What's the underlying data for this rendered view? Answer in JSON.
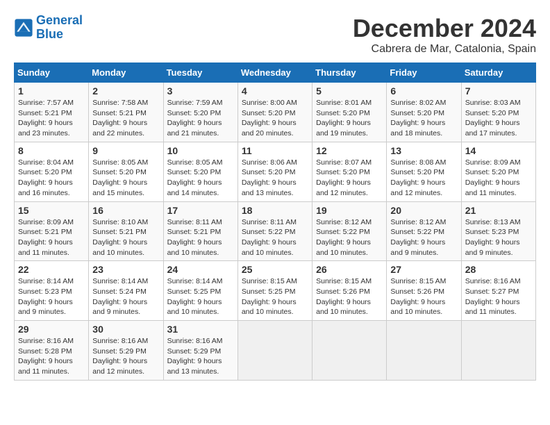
{
  "logo": {
    "line1": "General",
    "line2": "Blue"
  },
  "title": "December 2024",
  "subtitle": "Cabrera de Mar, Catalonia, Spain",
  "header": {
    "colors": {
      "accent": "#1a6eb5"
    }
  },
  "weekdays": [
    "Sunday",
    "Monday",
    "Tuesday",
    "Wednesday",
    "Thursday",
    "Friday",
    "Saturday"
  ],
  "weeks": [
    [
      {
        "day": "1",
        "sunrise": "7:57 AM",
        "sunset": "5:21 PM",
        "daylight": "9 hours and 23 minutes."
      },
      {
        "day": "2",
        "sunrise": "7:58 AM",
        "sunset": "5:21 PM",
        "daylight": "9 hours and 22 minutes."
      },
      {
        "day": "3",
        "sunrise": "7:59 AM",
        "sunset": "5:20 PM",
        "daylight": "9 hours and 21 minutes."
      },
      {
        "day": "4",
        "sunrise": "8:00 AM",
        "sunset": "5:20 PM",
        "daylight": "9 hours and 20 minutes."
      },
      {
        "day": "5",
        "sunrise": "8:01 AM",
        "sunset": "5:20 PM",
        "daylight": "9 hours and 19 minutes."
      },
      {
        "day": "6",
        "sunrise": "8:02 AM",
        "sunset": "5:20 PM",
        "daylight": "9 hours and 18 minutes."
      },
      {
        "day": "7",
        "sunrise": "8:03 AM",
        "sunset": "5:20 PM",
        "daylight": "9 hours and 17 minutes."
      }
    ],
    [
      {
        "day": "8",
        "sunrise": "8:04 AM",
        "sunset": "5:20 PM",
        "daylight": "9 hours and 16 minutes."
      },
      {
        "day": "9",
        "sunrise": "8:05 AM",
        "sunset": "5:20 PM",
        "daylight": "9 hours and 15 minutes."
      },
      {
        "day": "10",
        "sunrise": "8:05 AM",
        "sunset": "5:20 PM",
        "daylight": "9 hours and 14 minutes."
      },
      {
        "day": "11",
        "sunrise": "8:06 AM",
        "sunset": "5:20 PM",
        "daylight": "9 hours and 13 minutes."
      },
      {
        "day": "12",
        "sunrise": "8:07 AM",
        "sunset": "5:20 PM",
        "daylight": "9 hours and 12 minutes."
      },
      {
        "day": "13",
        "sunrise": "8:08 AM",
        "sunset": "5:20 PM",
        "daylight": "9 hours and 12 minutes."
      },
      {
        "day": "14",
        "sunrise": "8:09 AM",
        "sunset": "5:20 PM",
        "daylight": "9 hours and 11 minutes."
      }
    ],
    [
      {
        "day": "15",
        "sunrise": "8:09 AM",
        "sunset": "5:21 PM",
        "daylight": "9 hours and 11 minutes."
      },
      {
        "day": "16",
        "sunrise": "8:10 AM",
        "sunset": "5:21 PM",
        "daylight": "9 hours and 10 minutes."
      },
      {
        "day": "17",
        "sunrise": "8:11 AM",
        "sunset": "5:21 PM",
        "daylight": "9 hours and 10 minutes."
      },
      {
        "day": "18",
        "sunrise": "8:11 AM",
        "sunset": "5:22 PM",
        "daylight": "9 hours and 10 minutes."
      },
      {
        "day": "19",
        "sunrise": "8:12 AM",
        "sunset": "5:22 PM",
        "daylight": "9 hours and 10 minutes."
      },
      {
        "day": "20",
        "sunrise": "8:12 AM",
        "sunset": "5:22 PM",
        "daylight": "9 hours and 9 minutes."
      },
      {
        "day": "21",
        "sunrise": "8:13 AM",
        "sunset": "5:23 PM",
        "daylight": "9 hours and 9 minutes."
      }
    ],
    [
      {
        "day": "22",
        "sunrise": "8:14 AM",
        "sunset": "5:23 PM",
        "daylight": "9 hours and 9 minutes."
      },
      {
        "day": "23",
        "sunrise": "8:14 AM",
        "sunset": "5:24 PM",
        "daylight": "9 hours and 9 minutes."
      },
      {
        "day": "24",
        "sunrise": "8:14 AM",
        "sunset": "5:25 PM",
        "daylight": "9 hours and 10 minutes."
      },
      {
        "day": "25",
        "sunrise": "8:15 AM",
        "sunset": "5:25 PM",
        "daylight": "9 hours and 10 minutes."
      },
      {
        "day": "26",
        "sunrise": "8:15 AM",
        "sunset": "5:26 PM",
        "daylight": "9 hours and 10 minutes."
      },
      {
        "day": "27",
        "sunrise": "8:15 AM",
        "sunset": "5:26 PM",
        "daylight": "9 hours and 10 minutes."
      },
      {
        "day": "28",
        "sunrise": "8:16 AM",
        "sunset": "5:27 PM",
        "daylight": "9 hours and 11 minutes."
      }
    ],
    [
      {
        "day": "29",
        "sunrise": "8:16 AM",
        "sunset": "5:28 PM",
        "daylight": "9 hours and 11 minutes."
      },
      {
        "day": "30",
        "sunrise": "8:16 AM",
        "sunset": "5:29 PM",
        "daylight": "9 hours and 12 minutes."
      },
      {
        "day": "31",
        "sunrise": "8:16 AM",
        "sunset": "5:29 PM",
        "daylight": "9 hours and 13 minutes."
      },
      null,
      null,
      null,
      null
    ]
  ]
}
